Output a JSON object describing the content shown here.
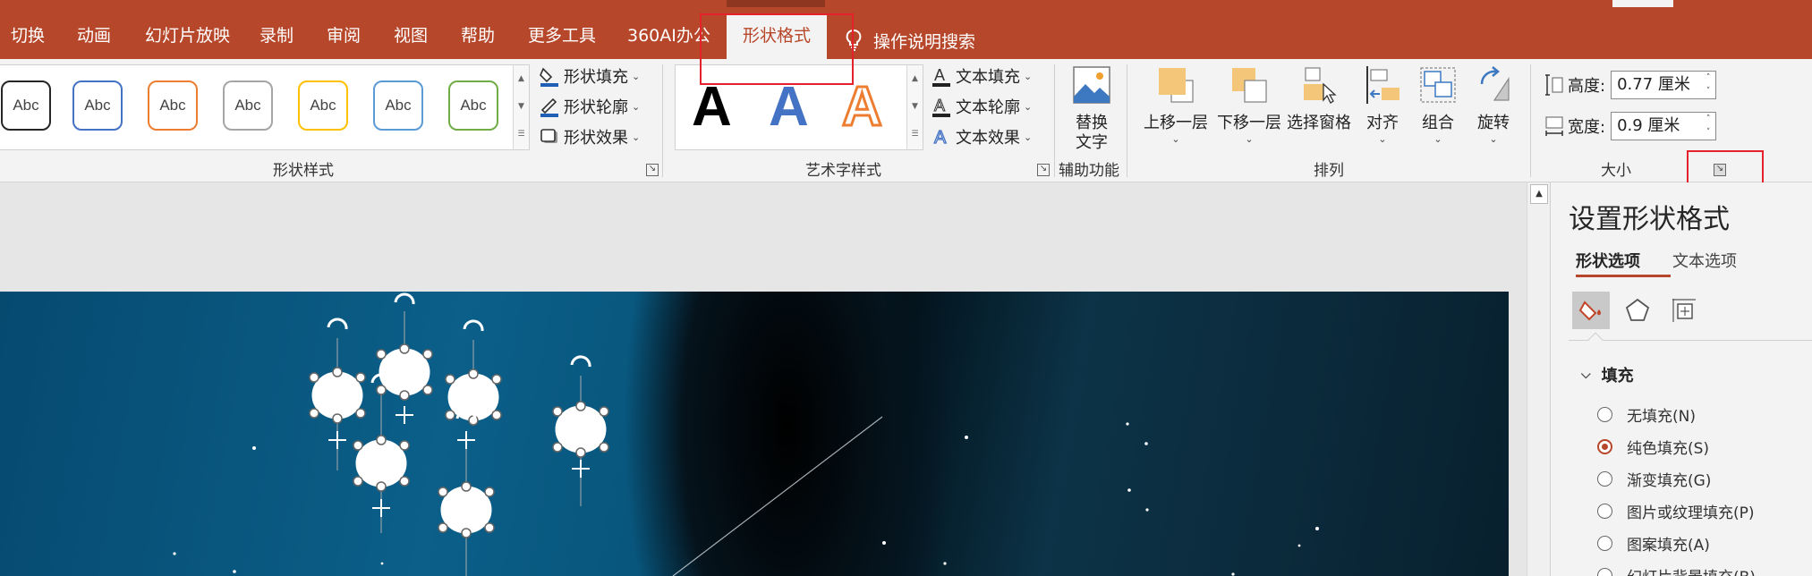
{
  "tabs": [
    {
      "label": "切换"
    },
    {
      "label": "动画"
    },
    {
      "label": "幻灯片放映"
    },
    {
      "label": "录制"
    },
    {
      "label": "审阅"
    },
    {
      "label": "视图"
    },
    {
      "label": "帮助"
    },
    {
      "label": "更多工具"
    },
    {
      "label": "360AI办公"
    },
    {
      "label": "形状格式"
    }
  ],
  "tell_me": "操作说明搜索",
  "ribbon": {
    "shape_styles": {
      "group_label": "形状样式",
      "thumb_text": "Abc",
      "thumb_colors": [
        "#262626",
        "#4472c4",
        "#ed7d31",
        "#a5a5a5",
        "#ffc000",
        "#5b9bd5",
        "#70ad47"
      ],
      "fill_label": "形状填充",
      "outline_label": "形状轮廓",
      "effect_label": "形状效果"
    },
    "wordart_styles": {
      "group_label": "艺术字样式",
      "sample_letter": "A",
      "text_fill_label": "文本填充",
      "text_outline_label": "文本轮廓",
      "text_effect_label": "文本效果"
    },
    "accessibility": {
      "group_label": "辅助功能",
      "alt_text_line1": "替换",
      "alt_text_line2": "文字"
    },
    "arrange": {
      "group_label": "排列",
      "bring_forward": "上移一层",
      "send_backward": "下移一层",
      "selection_pane": "选择窗格",
      "align": "对齐",
      "group": "组合",
      "rotate": "旋转"
    },
    "size": {
      "group_label": "大小",
      "height_label": "高度:",
      "height_value": "0.77 厘米",
      "width_label": "宽度:",
      "width_value": "0.9 厘米"
    }
  },
  "format_pane": {
    "title": "设置形状格式",
    "tab_shape": "形状选项",
    "tab_text": "文本选项",
    "section_fill": "填充",
    "fill_options": [
      {
        "label": "无填充(N)",
        "checked": false
      },
      {
        "label": "纯色填充(S)",
        "checked": true
      },
      {
        "label": "渐变填充(G)",
        "checked": false
      },
      {
        "label": "图片或纹理填充(P)",
        "checked": false
      },
      {
        "label": "图案填充(A)",
        "checked": false
      },
      {
        "label": "幻灯片背景填充(B)",
        "checked": false
      }
    ]
  },
  "colors": {
    "accent": "#b7472a",
    "highlight_box": "#e3222a"
  }
}
